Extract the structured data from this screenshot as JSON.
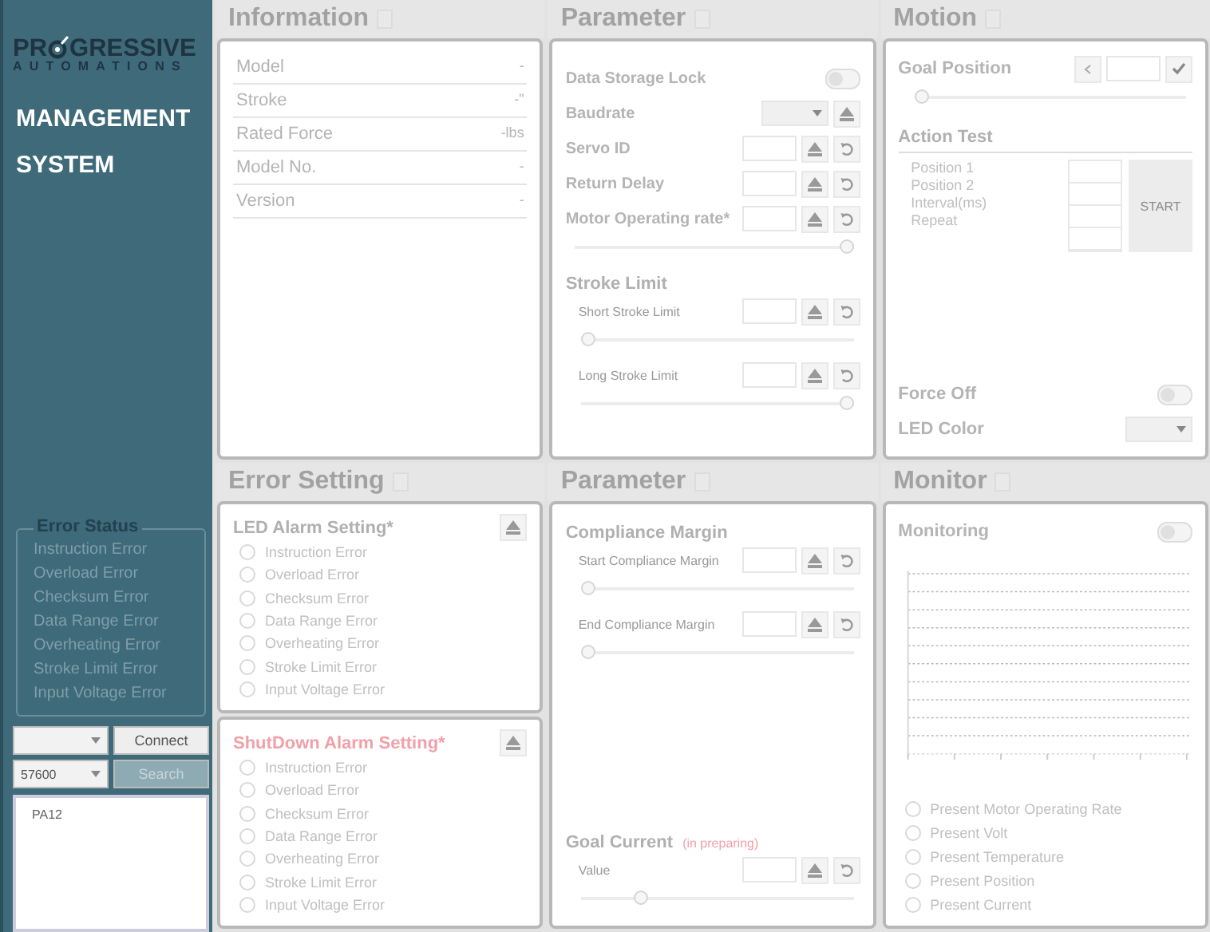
{
  "logo": {
    "before": "PR",
    "after": "GRESSIVE",
    "subtitle": "AUTOMATIONS"
  },
  "sidebar": {
    "title_lines": [
      "MANAGEMENT",
      "SYSTEM"
    ],
    "error_status": {
      "title": "Error Status",
      "items": [
        {
          "label": "Instruction Error",
          "active": false
        },
        {
          "label": "Overload Error",
          "active": false
        },
        {
          "label": "Checksum Error",
          "active": false
        },
        {
          "label": "Data Range Error",
          "active": false
        },
        {
          "label": "Overheating Error",
          "active": false
        },
        {
          "label": "Stroke Limit Error",
          "active": false
        },
        {
          "label": "Input Voltage Error",
          "active": false
        }
      ]
    },
    "connect_button": {
      "label": "Connect",
      "disabled": false
    },
    "baud_select": {
      "value": "57600"
    },
    "search_button": {
      "label": "Search",
      "disabled": true
    },
    "devices": [
      {
        "label": "PA12",
        "selected": false
      }
    ]
  },
  "information": {
    "title": "Information",
    "rows": [
      {
        "label": "Model",
        "value": "-"
      },
      {
        "label": "Stroke",
        "value": "-\""
      },
      {
        "label": "Rated Force",
        "value": "-lbs"
      },
      {
        "label": "Model No.",
        "value": "-"
      },
      {
        "label": "Version",
        "value": "-"
      }
    ]
  },
  "parameter_top": {
    "title": "Parameter",
    "groups": [
      {
        "items": [
          {
            "kind": "toggle",
            "label": "Data Storage Lock",
            "on": false
          },
          {
            "kind": "select",
            "label": "Baudrate",
            "disabled": true
          },
          {
            "kind": "input",
            "label": "Servo ID"
          },
          {
            "kind": "input",
            "label": "Return Delay"
          },
          {
            "kind": "slider",
            "label": "Motor Operating rate*",
            "level": 1,
            "sub": false
          }
        ]
      },
      {
        "title": "Stroke Limit",
        "items": [
          {
            "kind": "slider",
            "label": "Short Stroke Limit",
            "level": 0,
            "sub": true
          },
          {
            "kind": "slider",
            "label": "Long Stroke Limit",
            "level": 1,
            "sub": true
          }
        ]
      }
    ]
  },
  "motion": {
    "title": "Motion",
    "goal_position": {
      "label": "Goal Position",
      "level": 0
    },
    "action_test": {
      "title": "Action Test",
      "fields": [
        "Position 1",
        "Position 2",
        "Interval(ms)",
        "Repeat"
      ],
      "start_button": "START"
    },
    "force_off": {
      "label": "Force Off",
      "on": false
    },
    "led_color": {
      "label": "LED Color"
    }
  },
  "error_setting": {
    "title": "Error Setting",
    "groups": [
      {
        "title": "LED Alarm Setting*",
        "warning": false,
        "items": [
          {
            "label": "Instruction Error",
            "checked": false
          },
          {
            "label": "Overload Error",
            "checked": false
          },
          {
            "label": "Checksum Error",
            "checked": false
          },
          {
            "label": "Data Range Error",
            "checked": false
          },
          {
            "label": "Overheating Error",
            "checked": false
          },
          {
            "label": "Stroke Limit  Error",
            "checked": false
          },
          {
            "label": "Input Voltage Error",
            "checked": false
          }
        ]
      },
      {
        "title": "ShutDown Alarm Setting*",
        "warning": true,
        "items": [
          {
            "label": "Instruction Error",
            "checked": false
          },
          {
            "label": "Overload Error",
            "checked": false
          },
          {
            "label": "Checksum Error",
            "checked": false
          },
          {
            "label": "Data Range Error",
            "checked": false
          },
          {
            "label": "Overheating Error",
            "checked": false
          },
          {
            "label": "Stroke Limit  Error",
            "checked": false
          },
          {
            "label": "Input Voltage Error",
            "checked": false
          }
        ]
      }
    ]
  },
  "parameter_bottom": {
    "title": "Parameter",
    "groups": [
      {
        "title": "Compliance Margin",
        "items": [
          {
            "kind": "slider",
            "label": "Start Compliance Margin",
            "level": 0,
            "sub": true
          },
          {
            "kind": "slider",
            "label": "End Compliance Margin",
            "level": 0,
            "sub": true
          }
        ]
      },
      {
        "title": "Goal Current",
        "note": "(in preparing)",
        "items": [
          {
            "kind": "slider",
            "label": "Value",
            "level": 0.2,
            "sub": true
          }
        ]
      }
    ]
  },
  "monitor": {
    "title": "Monitor",
    "monitoring": {
      "label": "Monitoring",
      "on": false
    },
    "series": [
      {
        "label": "Present Motor Operating Rate",
        "checked": false
      },
      {
        "label": "Present Volt",
        "checked": false
      },
      {
        "label": "Present Temperature",
        "checked": false
      },
      {
        "label": "Present Position",
        "checked": false
      },
      {
        "label": "Present Current",
        "checked": false
      }
    ]
  }
}
